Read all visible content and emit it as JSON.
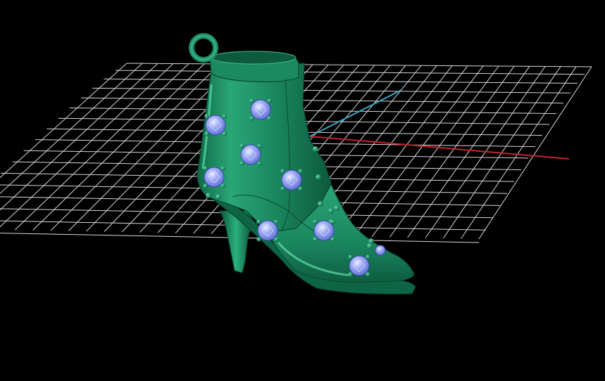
{
  "viewport": {
    "background": "#000000",
    "grid_color": "#d8d8d8",
    "axis_x_color": "#c0262c",
    "axis_y_color": "#3aa7c4",
    "model_color": "#1e8f66",
    "model_highlight": "#4fd6a0",
    "model_shadow": "#0a4d36",
    "gem_color": "#8c9cf2",
    "gem_highlight": "#e4e8ff",
    "prong_color": "#137a52"
  },
  "model": {
    "kind": "ankle-boot-pendant",
    "parts": [
      "bail-ring",
      "collar",
      "shaft",
      "vamp",
      "sole",
      "heel"
    ],
    "gem_count": 9
  }
}
